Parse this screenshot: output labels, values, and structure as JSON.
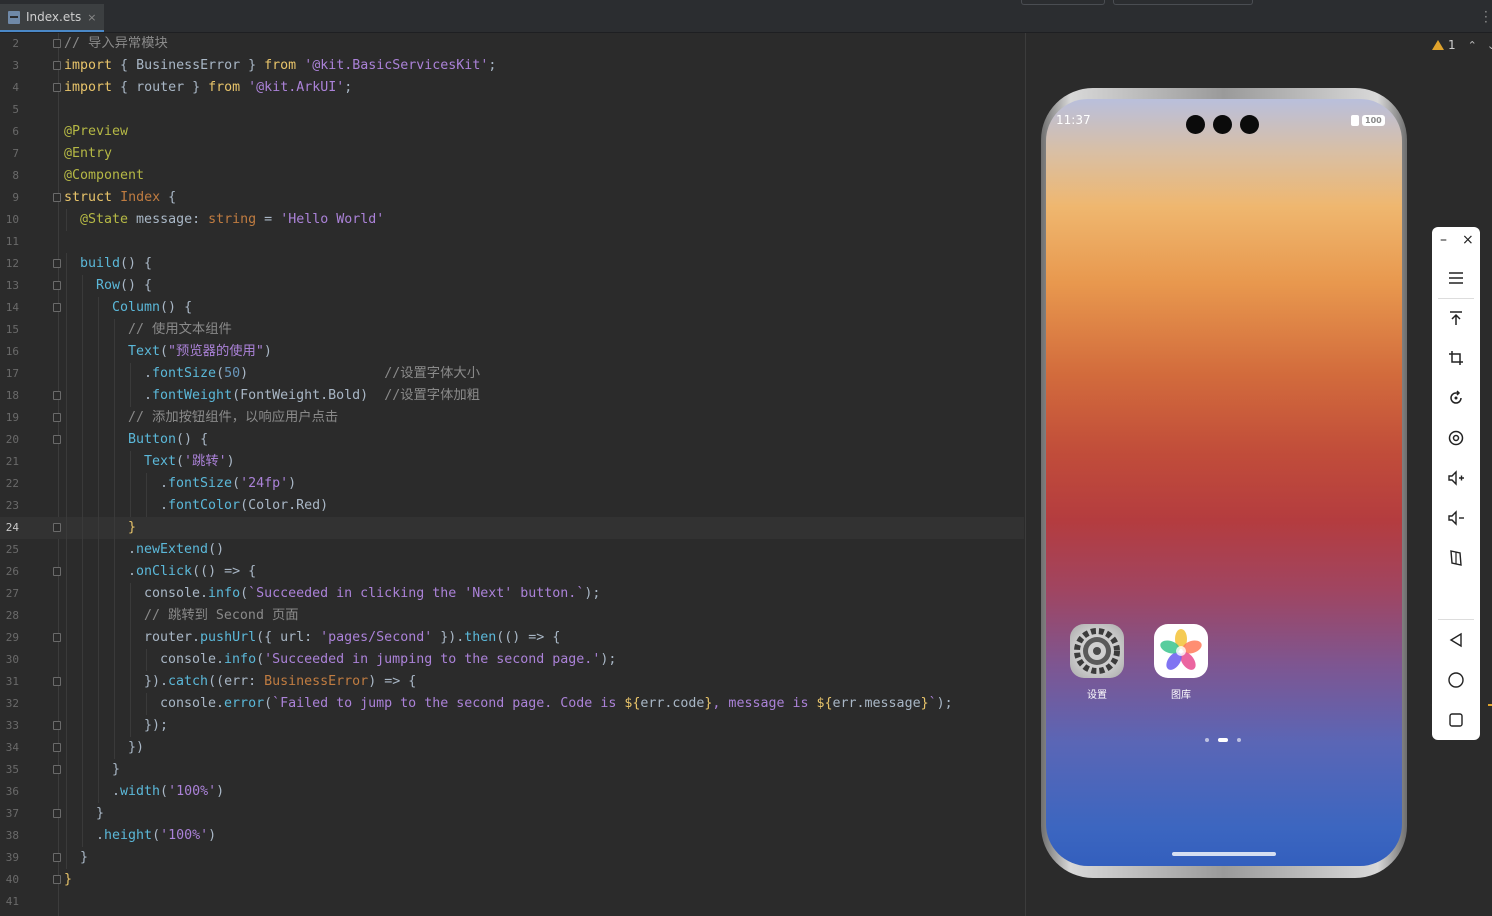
{
  "tab": {
    "label": "Index.ets",
    "close": "×"
  },
  "warnings": {
    "count": "1",
    "up": "⌃",
    "down": "⌄"
  },
  "editor": {
    "current_line": "24",
    "lines": [
      {
        "n": "2",
        "fold": true,
        "indent": 0,
        "tokens": [
          [
            "cmt",
            "// 导入异常模块"
          ]
        ]
      },
      {
        "n": "3",
        "fold": true,
        "indent": 0,
        "tokens": [
          [
            "kw",
            "import"
          ],
          [
            "pl",
            " { BusinessError } "
          ],
          [
            "kw",
            "from"
          ],
          [
            "pl",
            " "
          ],
          [
            "str",
            "'@kit.BasicServicesKit'"
          ],
          [
            "pl",
            ";"
          ]
        ]
      },
      {
        "n": "4",
        "fold": true,
        "indent": 0,
        "tokens": [
          [
            "kw",
            "import"
          ],
          [
            "pl",
            " { router } "
          ],
          [
            "kw",
            "from"
          ],
          [
            "pl",
            " "
          ],
          [
            "str",
            "'@kit.ArkUI'"
          ],
          [
            "pl",
            ";"
          ]
        ]
      },
      {
        "n": "5",
        "fold": false,
        "indent": 0,
        "tokens": []
      },
      {
        "n": "6",
        "fold": false,
        "indent": 0,
        "tokens": [
          [
            "dec",
            "@Preview"
          ]
        ]
      },
      {
        "n": "7",
        "fold": false,
        "indent": 0,
        "tokens": [
          [
            "dec",
            "@Entry"
          ]
        ]
      },
      {
        "n": "8",
        "fold": false,
        "indent": 0,
        "tokens": [
          [
            "dec",
            "@Component"
          ]
        ]
      },
      {
        "n": "9",
        "fold": true,
        "indent": 0,
        "tokens": [
          [
            "kw",
            "struct"
          ],
          [
            "pl",
            " "
          ],
          [
            "typ",
            "Index"
          ],
          [
            "pl",
            " {"
          ]
        ]
      },
      {
        "n": "10",
        "fold": false,
        "indent": 1,
        "tokens": [
          [
            "dec",
            "@State"
          ],
          [
            "pl",
            " message: "
          ],
          [
            "typ",
            "string"
          ],
          [
            "pl",
            " = "
          ],
          [
            "str",
            "'Hello World'"
          ]
        ]
      },
      {
        "n": "11",
        "fold": false,
        "indent": 0,
        "tokens": []
      },
      {
        "n": "12",
        "fold": true,
        "indent": 1,
        "tokens": [
          [
            "fn",
            "build"
          ],
          [
            "pl",
            "() {"
          ]
        ]
      },
      {
        "n": "13",
        "fold": true,
        "indent": 2,
        "tokens": [
          [
            "fn",
            "Row"
          ],
          [
            "pl",
            "() {"
          ]
        ]
      },
      {
        "n": "14",
        "fold": true,
        "indent": 3,
        "tokens": [
          [
            "fn",
            "Column"
          ],
          [
            "pl",
            "() {"
          ]
        ]
      },
      {
        "n": "15",
        "fold": false,
        "indent": 4,
        "tokens": [
          [
            "cmt",
            "// 使用文本组件"
          ]
        ]
      },
      {
        "n": "16",
        "fold": false,
        "indent": 4,
        "tokens": [
          [
            "fn",
            "Text"
          ],
          [
            "pl",
            "("
          ],
          [
            "str",
            "\"预览器的使用\""
          ],
          [
            "pl",
            ")"
          ]
        ]
      },
      {
        "n": "17",
        "fold": false,
        "indent": 5,
        "tokens": [
          [
            "pl",
            "."
          ],
          [
            "fn",
            "fontSize"
          ],
          [
            "pl",
            "("
          ],
          [
            "num",
            "50"
          ],
          [
            "pl",
            ")                 "
          ],
          [
            "cmt",
            "//设置字体大小"
          ]
        ]
      },
      {
        "n": "18",
        "fold": true,
        "indent": 5,
        "tokens": [
          [
            "pl",
            "."
          ],
          [
            "fn",
            "fontWeight"
          ],
          [
            "pl",
            "(FontWeight.Bold)  "
          ],
          [
            "cmt",
            "//设置字体加粗"
          ]
        ]
      },
      {
        "n": "19",
        "fold": true,
        "indent": 4,
        "tokens": [
          [
            "cmt",
            "// 添加按钮组件，以响应用户点击"
          ]
        ]
      },
      {
        "n": "20",
        "fold": true,
        "indent": 4,
        "tokens": [
          [
            "fn",
            "Button"
          ],
          [
            "pl",
            "() {"
          ]
        ]
      },
      {
        "n": "21",
        "fold": false,
        "indent": 5,
        "tokens": [
          [
            "fn",
            "Text"
          ],
          [
            "pl",
            "("
          ],
          [
            "str",
            "'跳转'"
          ],
          [
            "pl",
            ")"
          ]
        ]
      },
      {
        "n": "22",
        "fold": false,
        "indent": 6,
        "tokens": [
          [
            "pl",
            "."
          ],
          [
            "fn",
            "fontSize"
          ],
          [
            "pl",
            "("
          ],
          [
            "str",
            "'24fp'"
          ],
          [
            "pl",
            ")"
          ]
        ]
      },
      {
        "n": "23",
        "fold": false,
        "indent": 6,
        "tokens": [
          [
            "pl",
            "."
          ],
          [
            "fn",
            "fontColor"
          ],
          [
            "pl",
            "(Color.Red)"
          ]
        ]
      },
      {
        "n": "24",
        "fold": true,
        "indent": 4,
        "tokens": [
          [
            "kw",
            "}"
          ]
        ]
      },
      {
        "n": "25",
        "fold": false,
        "indent": 4,
        "tokens": [
          [
            "pl",
            "."
          ],
          [
            "fn",
            "newExtend"
          ],
          [
            "pl",
            "()"
          ]
        ]
      },
      {
        "n": "26",
        "fold": true,
        "indent": 4,
        "tokens": [
          [
            "pl",
            "."
          ],
          [
            "fn",
            "onClick"
          ],
          [
            "pl",
            "(() => {"
          ]
        ]
      },
      {
        "n": "27",
        "fold": false,
        "indent": 5,
        "tokens": [
          [
            "pl",
            "console."
          ],
          [
            "fn",
            "info"
          ],
          [
            "pl",
            "("
          ],
          [
            "str",
            "`Succeeded in clicking the 'Next' button.`"
          ],
          [
            "pl",
            ");"
          ]
        ]
      },
      {
        "n": "28",
        "fold": false,
        "indent": 5,
        "tokens": [
          [
            "cmt",
            "// 跳转到 Second 页面"
          ]
        ]
      },
      {
        "n": "29",
        "fold": true,
        "indent": 5,
        "tokens": [
          [
            "pl",
            "router."
          ],
          [
            "fn",
            "pushUrl"
          ],
          [
            "pl",
            "({ url: "
          ],
          [
            "str",
            "'pages/Second'"
          ],
          [
            "pl",
            " })."
          ],
          [
            "fn",
            "then"
          ],
          [
            "pl",
            "(() => {"
          ]
        ]
      },
      {
        "n": "30",
        "fold": false,
        "indent": 6,
        "tokens": [
          [
            "pl",
            "console."
          ],
          [
            "fn",
            "info"
          ],
          [
            "pl",
            "("
          ],
          [
            "str",
            "'Succeeded in jumping to the second page.'"
          ],
          [
            "pl",
            ");"
          ]
        ]
      },
      {
        "n": "31",
        "fold": true,
        "indent": 5,
        "tokens": [
          [
            "pl",
            "})."
          ],
          [
            "fn",
            "catch"
          ],
          [
            "pl",
            "((err: "
          ],
          [
            "typ",
            "BusinessError"
          ],
          [
            "pl",
            ") => {"
          ]
        ]
      },
      {
        "n": "32",
        "fold": false,
        "indent": 6,
        "tokens": [
          [
            "pl",
            "console."
          ],
          [
            "fn",
            "error"
          ],
          [
            "pl",
            "("
          ],
          [
            "str",
            "`Failed to jump to the second page. Code is "
          ],
          [
            "kw",
            "${"
          ],
          [
            "pl",
            "err.code"
          ],
          [
            "kw",
            "}"
          ],
          [
            "str",
            ", message is "
          ],
          [
            "kw",
            "${"
          ],
          [
            "pl",
            "err.message"
          ],
          [
            "kw",
            "}"
          ],
          [
            "str",
            "`"
          ],
          [
            "pl",
            ");"
          ]
        ]
      },
      {
        "n": "33",
        "fold": true,
        "indent": 5,
        "tokens": [
          [
            "pl",
            "});"
          ]
        ]
      },
      {
        "n": "34",
        "fold": true,
        "indent": 4,
        "tokens": [
          [
            "pl",
            "})"
          ]
        ]
      },
      {
        "n": "35",
        "fold": true,
        "indent": 3,
        "tokens": [
          [
            "pl",
            "}"
          ]
        ]
      },
      {
        "n": "36",
        "fold": false,
        "indent": 3,
        "tokens": [
          [
            "pl",
            "."
          ],
          [
            "fn",
            "width"
          ],
          [
            "pl",
            "("
          ],
          [
            "str",
            "'100%'"
          ],
          [
            "pl",
            ")"
          ]
        ]
      },
      {
        "n": "37",
        "fold": true,
        "indent": 2,
        "tokens": [
          [
            "pl",
            "}"
          ]
        ]
      },
      {
        "n": "38",
        "fold": false,
        "indent": 2,
        "tokens": [
          [
            "pl",
            "."
          ],
          [
            "fn",
            "height"
          ],
          [
            "pl",
            "("
          ],
          [
            "str",
            "'100%'"
          ],
          [
            "pl",
            ")"
          ]
        ]
      },
      {
        "n": "39",
        "fold": true,
        "indent": 1,
        "tokens": [
          [
            "pl",
            "}"
          ]
        ]
      },
      {
        "n": "40",
        "fold": true,
        "indent": 0,
        "tokens": [
          [
            "kw",
            "}"
          ]
        ]
      },
      {
        "n": "41",
        "fold": false,
        "indent": 0,
        "tokens": []
      }
    ]
  },
  "phone": {
    "time": "11:37",
    "battery": "100",
    "apps": [
      {
        "label": "设置",
        "icon": "settings-gear-icon"
      },
      {
        "label": "图库",
        "icon": "gallery-flower-icon"
      }
    ],
    "page_indicator": {
      "count": 3,
      "active": 1
    }
  },
  "side_toolbar": {
    "minimize": "–",
    "close": "×",
    "tools": [
      "menu-icon",
      "pin-top-icon",
      "crop-icon",
      "rotate-icon",
      "screenshot-icon",
      "volume-up-icon",
      "volume-down-icon",
      "fold-icon",
      "back-icon",
      "home-icon",
      "recents-icon"
    ]
  },
  "colors": {
    "accent": "#4a88c7",
    "warning": "#e0a32c",
    "keyword": "#e8c46a",
    "string": "#ab82d8",
    "function": "#5bb8d9"
  }
}
